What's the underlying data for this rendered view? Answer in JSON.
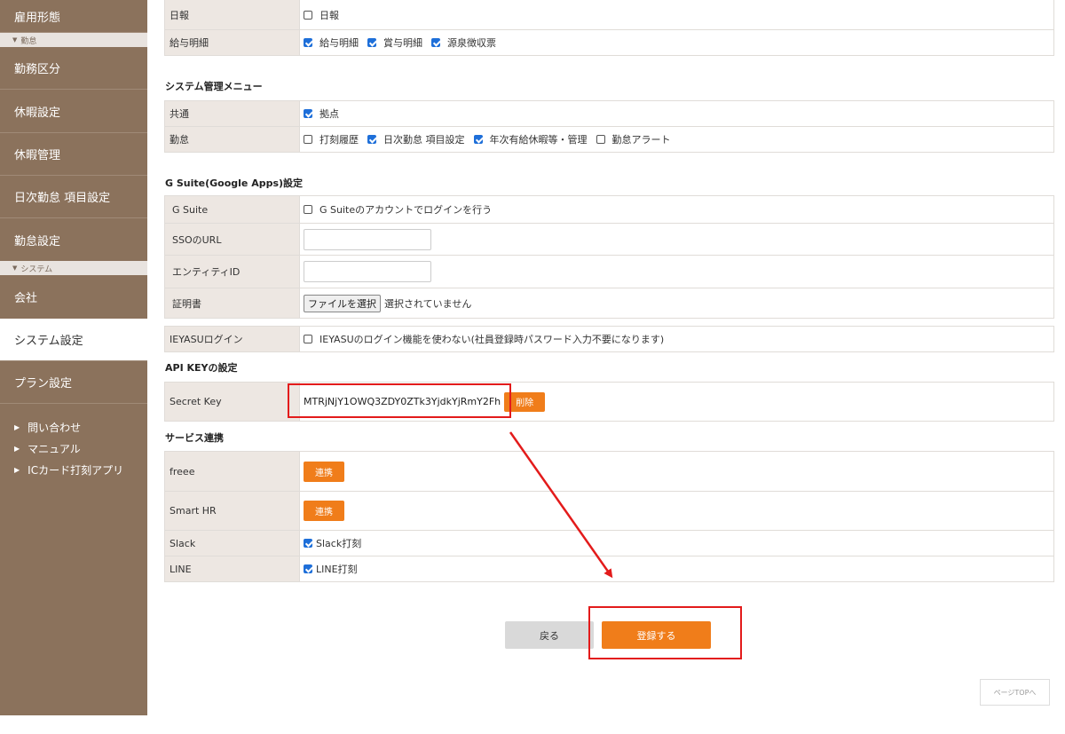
{
  "sidebar": {
    "items": [
      {
        "label": "雇用形態"
      },
      {
        "label": "勤務区分"
      },
      {
        "label": "休暇設定"
      },
      {
        "label": "休暇管理"
      },
      {
        "label": "日次勤怠 項目設定"
      },
      {
        "label": "勤怠設定"
      },
      {
        "label": "会社"
      },
      {
        "label": "システム設定"
      },
      {
        "label": "プラン設定"
      }
    ],
    "sections": [
      "勤怠",
      "システム"
    ],
    "links": [
      "問い合わせ",
      "マニュアル",
      "ICカード打刻アプリ"
    ]
  },
  "top_rows": [
    {
      "label": "日報",
      "checks": [
        {
          "label": "日報",
          "checked": false
        }
      ]
    },
    {
      "label": "給与明細",
      "checks": [
        {
          "label": "給与明細",
          "checked": true
        },
        {
          "label": "賞与明細",
          "checked": true
        },
        {
          "label": "源泉徴収票",
          "checked": true
        }
      ]
    }
  ],
  "system_menu": {
    "title": "システム管理メニュー",
    "rows": [
      {
        "label": "共通",
        "checks": [
          {
            "label": "拠点",
            "checked": true
          }
        ]
      },
      {
        "label": "勤怠",
        "checks": [
          {
            "label": "打刻履歴",
            "checked": false
          },
          {
            "label": "日次勤怠 項目設定",
            "checked": true
          },
          {
            "label": "年次有給休暇等・管理",
            "checked": true
          },
          {
            "label": "勤怠アラート",
            "checked": false
          }
        ]
      }
    ]
  },
  "gsuite": {
    "title": "G Suite(Google Apps)設定",
    "row_gsuite": {
      "label": "G Suite",
      "check_label": "G Suiteのアカウントでログインを行う",
      "checked": false
    },
    "row_sso": {
      "label": "SSOのURL",
      "value": ""
    },
    "row_entity": {
      "label": "エンティティID",
      "value": ""
    },
    "row_cert": {
      "label": "証明書",
      "button": "ファイルを選択",
      "note": "選択されていません"
    }
  },
  "ieyasu": {
    "label": "IEYASUログイン",
    "check_label": "IEYASUのログイン機能を使わない(社員登録時パスワード入力不要になります)",
    "checked": false
  },
  "api": {
    "title": "API KEYの設定",
    "label": "Secret Key",
    "value": "MTRjNjY1OWQ3ZDY0ZTk3YjdkYjRmY2Fh",
    "delete": "削除"
  },
  "services": {
    "title": "サービス連携",
    "freee": {
      "label": "freee",
      "button": "連携"
    },
    "smarthr": {
      "label": "Smart HR",
      "button": "連携"
    },
    "slack": {
      "label": "Slack",
      "check_label": "Slack打刻",
      "checked": true
    },
    "line": {
      "label": "LINE",
      "check_label": "LINE打刻",
      "checked": true
    }
  },
  "actions": {
    "back": "戻る",
    "submit": "登録する",
    "page_top": "ページTOPへ"
  },
  "colors": {
    "sidebar": "#8b725c",
    "accent": "#f07d1a",
    "annotation": "#e31b1b",
    "checkbox": "#1e6fd9"
  }
}
